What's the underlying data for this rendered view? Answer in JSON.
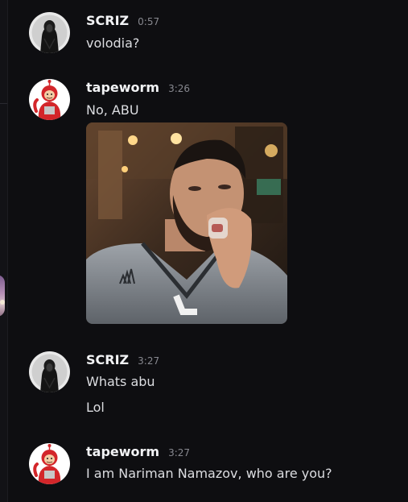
{
  "messages": [
    {
      "author": "SCRIZ",
      "time": "0:57",
      "avatar_icon": "hooded-figure-avatar",
      "lines": [
        "volodia?"
      ]
    },
    {
      "author": "tapeworm",
      "time": "3:26",
      "avatar_icon": "red-teletubby-avatar",
      "lines": [
        "No, ABU"
      ],
      "attachment": {
        "type": "image",
        "subject": "bearded man in grey hoodie holding a glass"
      }
    },
    {
      "author": "SCRIZ",
      "time": "3:27",
      "avatar_icon": "hooded-figure-avatar",
      "lines": [
        "Whats abu",
        "Lol"
      ]
    },
    {
      "author": "tapeworm",
      "time": "3:27",
      "avatar_icon": "red-teletubby-avatar",
      "lines": [
        "I am Nariman Namazov, who are you?"
      ]
    }
  ],
  "colors": {
    "background": "#0e0e11",
    "username": "#f2f3f5",
    "message_text": "#dcdde1",
    "timestamp": "#87888f"
  }
}
